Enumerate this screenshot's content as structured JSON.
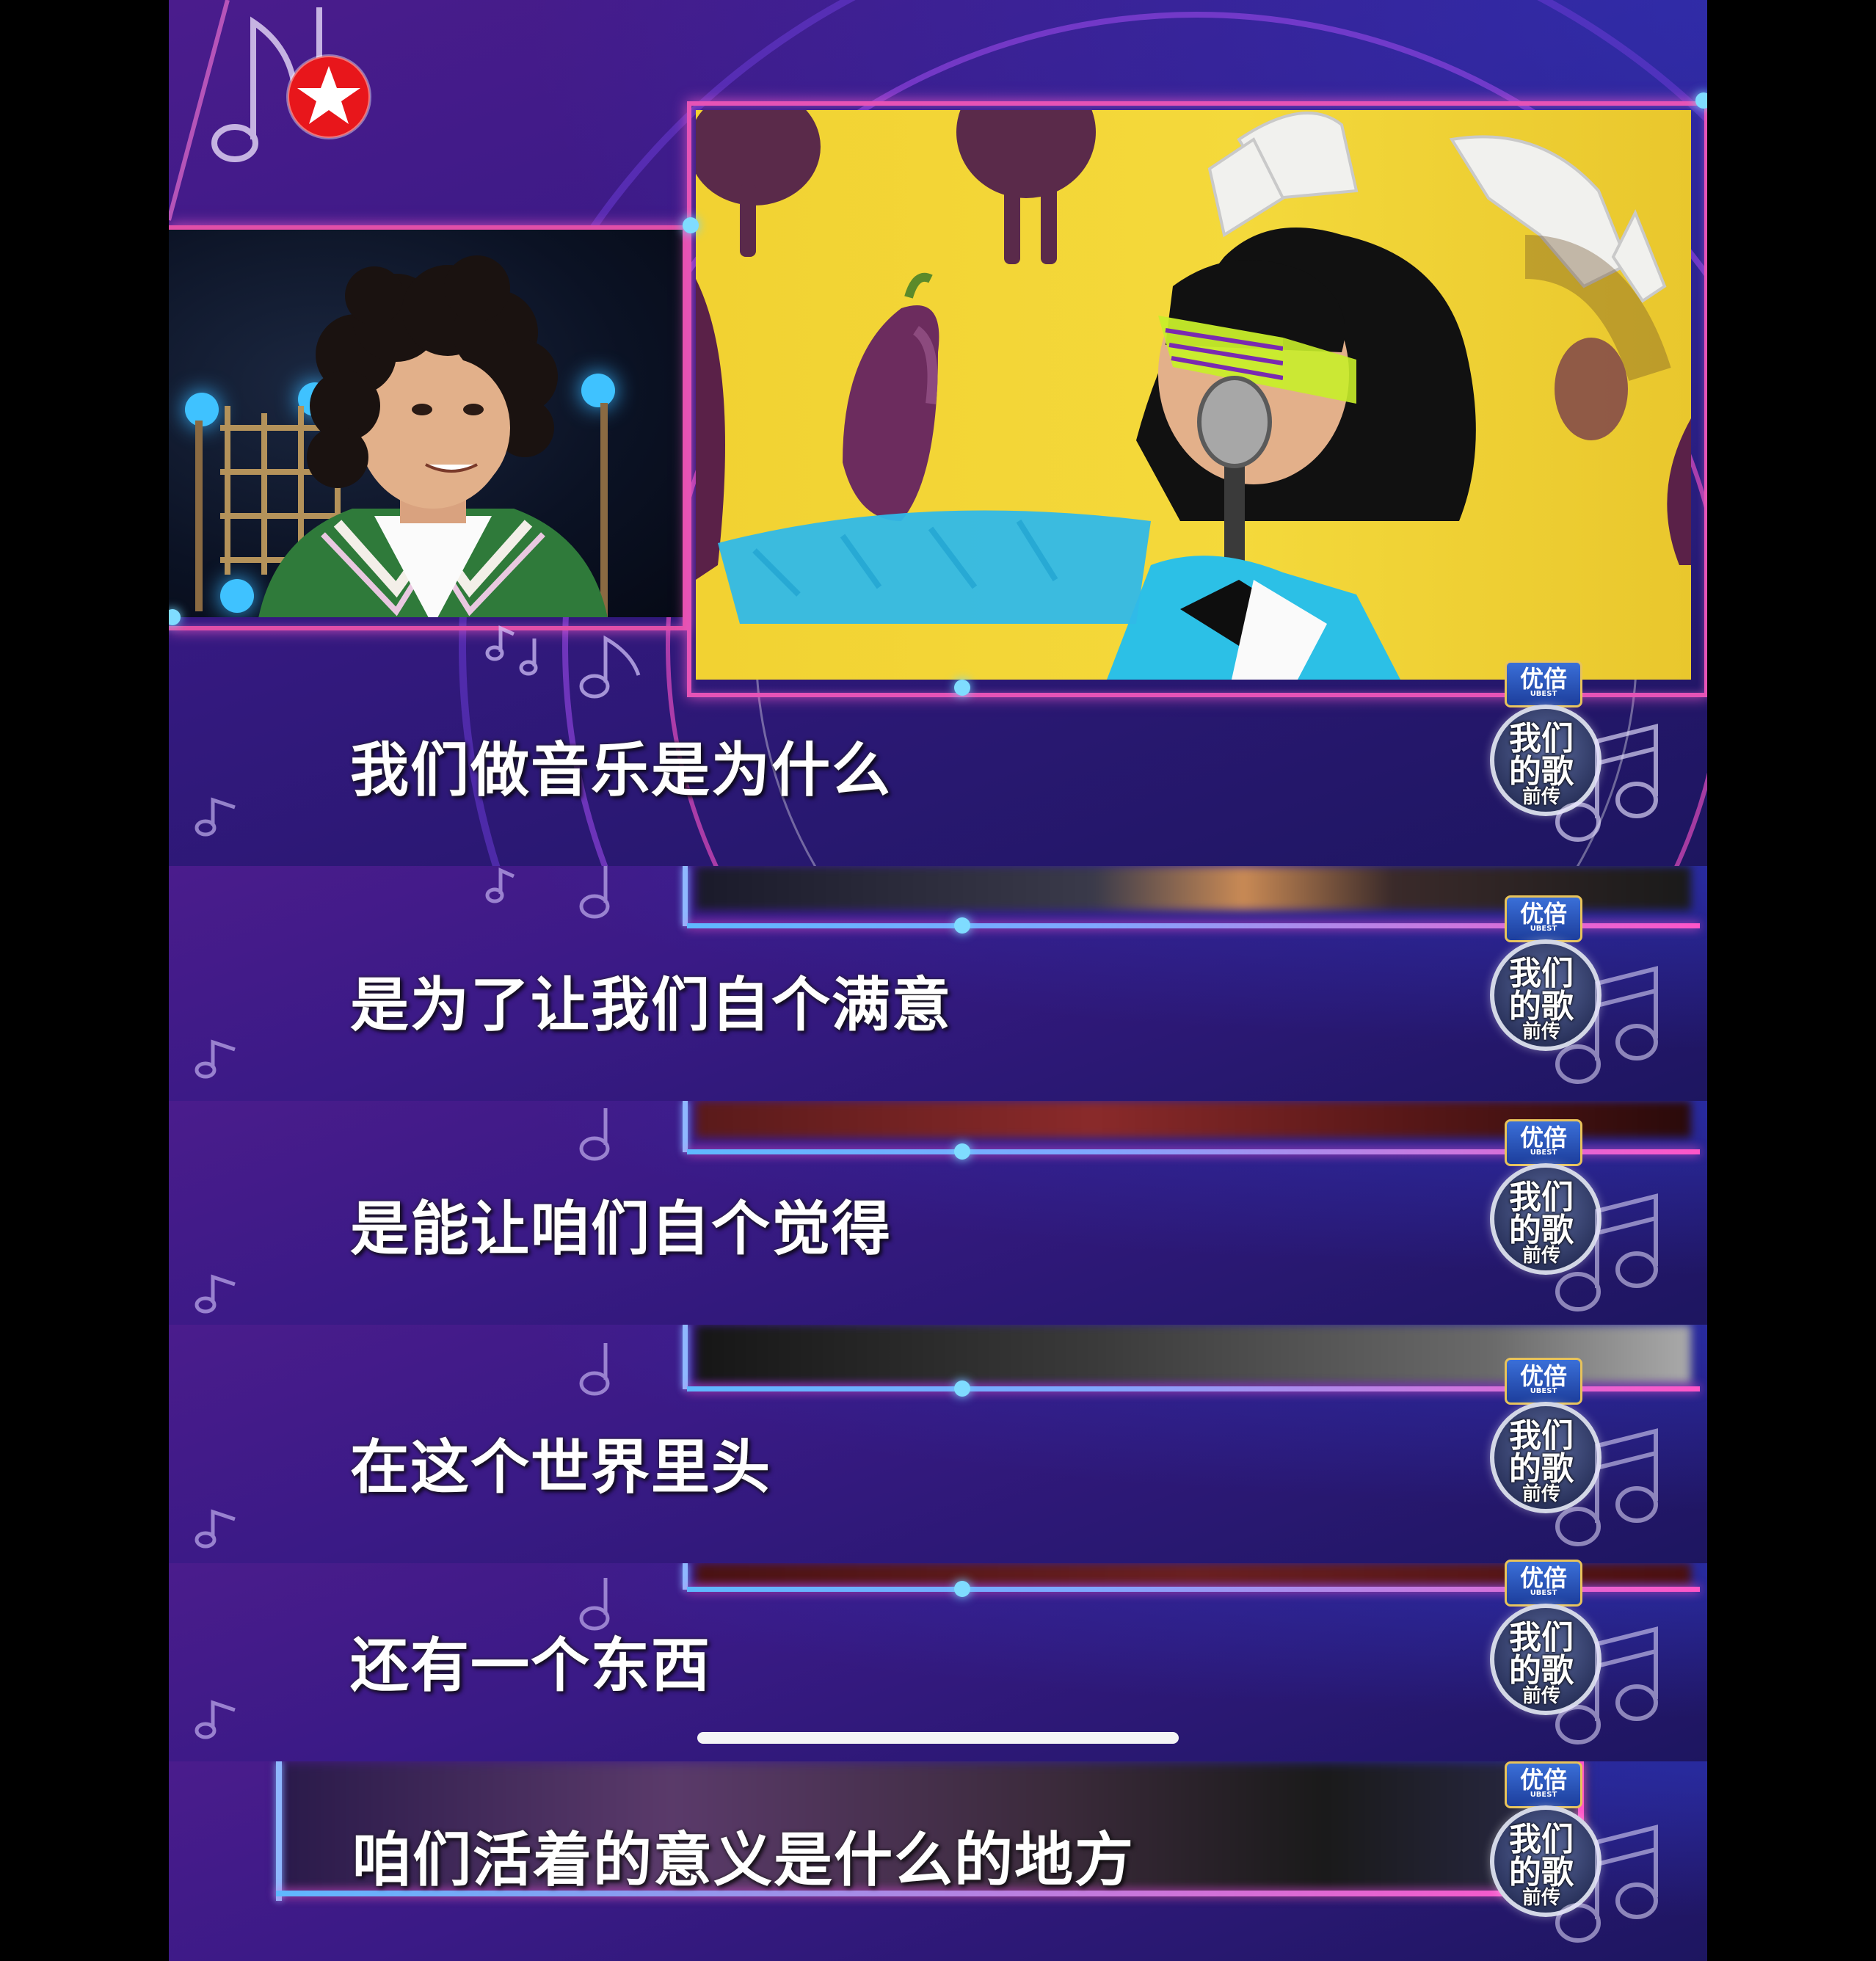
{
  "channel_logo": {
    "name": "star-channel-logo",
    "color": "#e8161b"
  },
  "show_logo": {
    "badge": "优倍",
    "badge_small": "UBEST",
    "title_line1": "我们",
    "title_line2": "的歌",
    "subtitle": "前传"
  },
  "subtitles": [
    "我们做音乐是为什么",
    "是为了让我们自个满意",
    "是能让咱们自个觉得",
    "在这个世界里头",
    "还有一个东西",
    "咱们活着的意义是什么的地方"
  ],
  "colors": {
    "neon_pink": "#e14fa8",
    "neon_blue": "#6fd8ff",
    "panel_purple": "#3a1a86",
    "stage_yellow": "#f2d232"
  }
}
